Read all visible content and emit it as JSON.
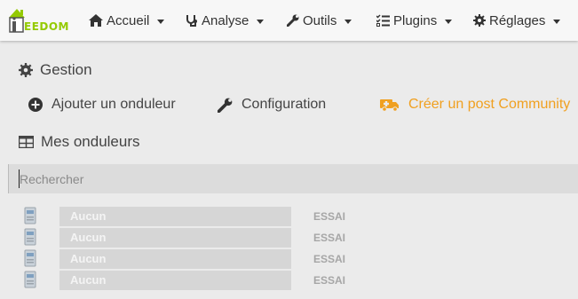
{
  "app": {
    "logo_text": "EEDOM",
    "brand_color": "#94ca02"
  },
  "nav": [
    {
      "label": "Accueil",
      "icon": "home-icon"
    },
    {
      "label": "Analyse",
      "icon": "stethoscope-icon"
    },
    {
      "label": "Outils",
      "icon": "wrench-icon"
    },
    {
      "label": "Plugins",
      "icon": "tasks-icon"
    },
    {
      "label": "Réglages",
      "icon": "gear-icon"
    }
  ],
  "gestion": {
    "title": "Gestion",
    "add_label": "Ajouter un onduleur",
    "config_label": "Configuration",
    "community_label": "Créer un post Community",
    "community_color": "#f0a020"
  },
  "mes": {
    "title": "Mes onduleurs"
  },
  "search": {
    "placeholder": "Rechercher"
  },
  "devices": [
    {
      "name": "Aucun",
      "type": "ESSAI"
    },
    {
      "name": "Aucun",
      "type": "ESSAI"
    },
    {
      "name": "Aucun",
      "type": "ESSAI"
    },
    {
      "name": "Aucun",
      "type": "ESSAI"
    }
  ]
}
